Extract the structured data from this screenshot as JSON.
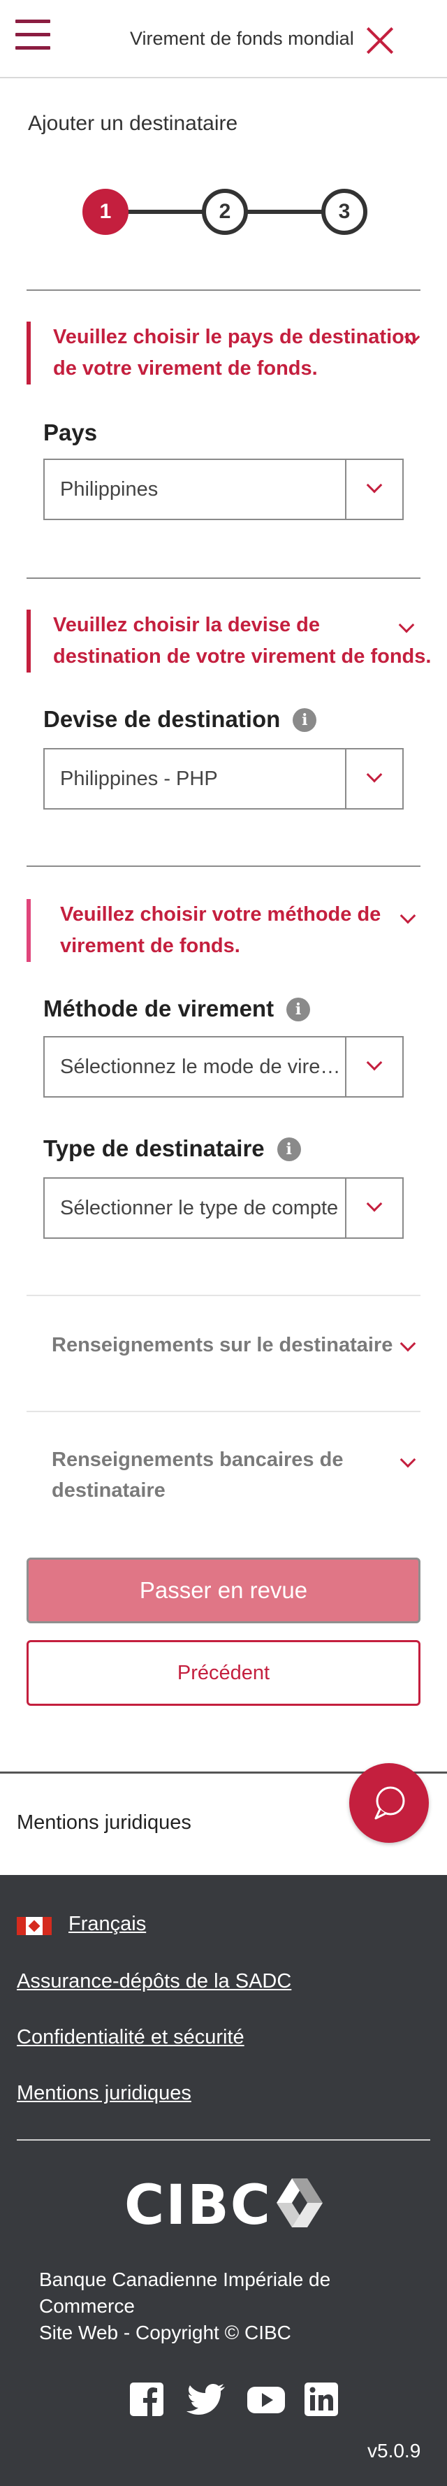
{
  "header": {
    "title": "Virement de fonds mondial"
  },
  "page": {
    "subtitle": "Ajouter un destinataire"
  },
  "stepper": {
    "steps": [
      "1",
      "2",
      "3"
    ],
    "current": 1
  },
  "country_section": {
    "message": "Veuillez choisir le pays de destination de votre virement de fonds.",
    "label": "Pays",
    "value": "Philippines"
  },
  "currency_section": {
    "message": "Veuillez choisir la devise de destination de votre virement de fonds.",
    "label": "Devise de destination",
    "value": "Philippines - PHP"
  },
  "method_section": {
    "message": "Veuillez choisir votre méthode de virement de fonds.",
    "method_label": "Méthode de virement",
    "method_placeholder": "Sélectionnez le mode de virement",
    "type_label": "Type de destinataire",
    "type_placeholder": "Sélectionner le type de compte"
  },
  "accordions": {
    "recipient_info": "Renseignements sur le destinataire",
    "bank_info": "Renseignements bancaires de destinataire"
  },
  "buttons": {
    "review": "Passer en revue",
    "previous": "Précédent"
  },
  "legal_bar": {
    "label": "Mentions juridiques"
  },
  "footer": {
    "language": "Français",
    "links": [
      "Assurance-dépôts de la SADC",
      "Confidentialité et sécurité",
      "Mentions juridiques"
    ],
    "logo": "CIBC",
    "company_line1": "Banque Canadienne Impériale de Commerce",
    "company_line2": "Site Web - Copyright © CIBC",
    "social": [
      "facebook-icon",
      "twitter-icon",
      "youtube-icon",
      "linkedin-icon"
    ],
    "version": "v5.0.9"
  },
  "colors": {
    "brand_red": "#c41f3e",
    "brand_maroon": "#8b1d41",
    "review_button": "#e07686",
    "footer_bg": "#383a3e"
  }
}
